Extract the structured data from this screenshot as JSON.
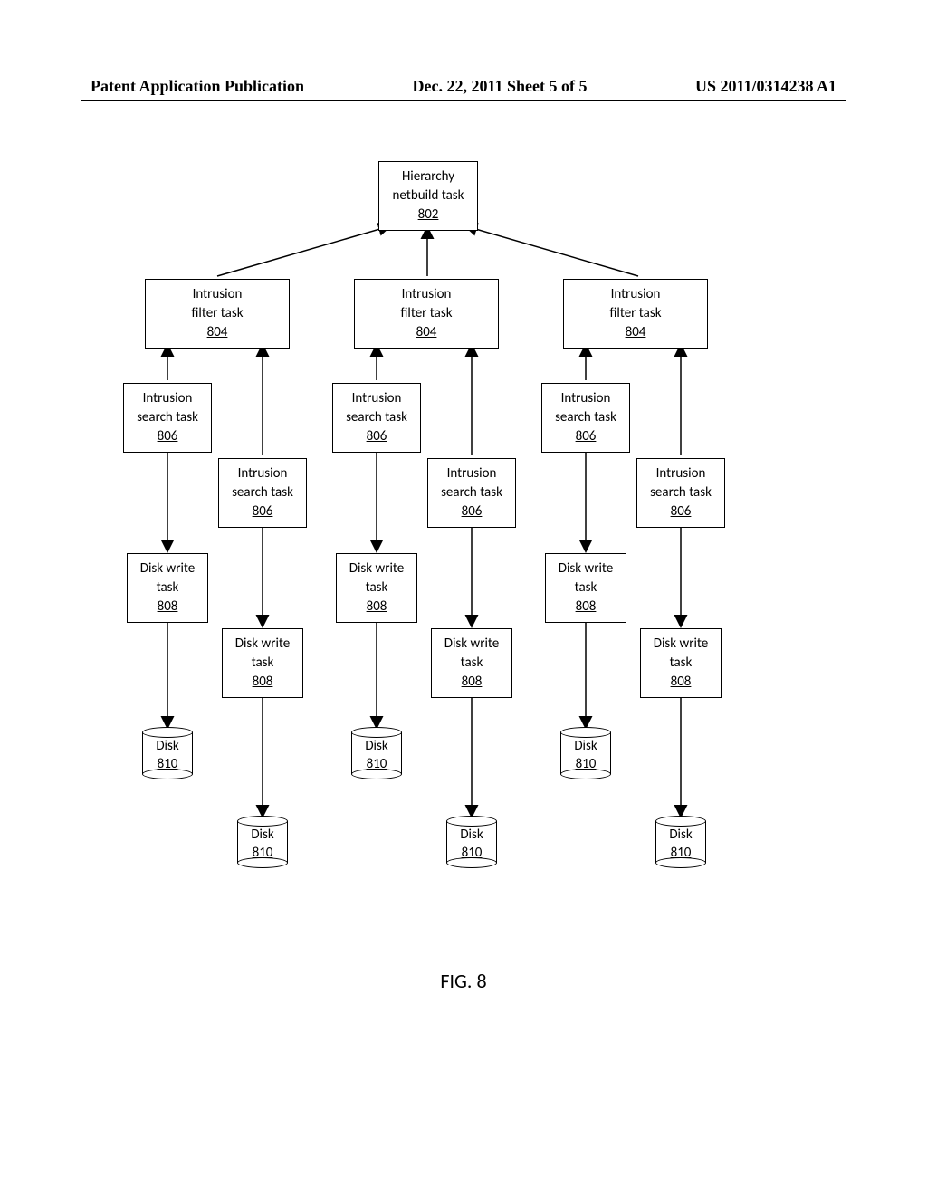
{
  "header": {
    "left": "Patent Application Publication",
    "center": "Dec. 22, 2011  Sheet 5 of 5",
    "right": "US 2011/0314238 A1"
  },
  "figure_label": "FIG. 8",
  "nodes": {
    "root": {
      "line1": "Hierarchy",
      "line2": "netbuild task",
      "ref": "802"
    },
    "filter": {
      "line1": "Intrusion",
      "line2": "filter task",
      "ref": "804"
    },
    "search": {
      "line1": "Intrusion",
      "line2": "search task",
      "ref": "806"
    },
    "write": {
      "line1": "Disk write",
      "line2": "task",
      "ref": "808"
    },
    "disk": {
      "line1": "Disk",
      "ref": "810"
    }
  }
}
